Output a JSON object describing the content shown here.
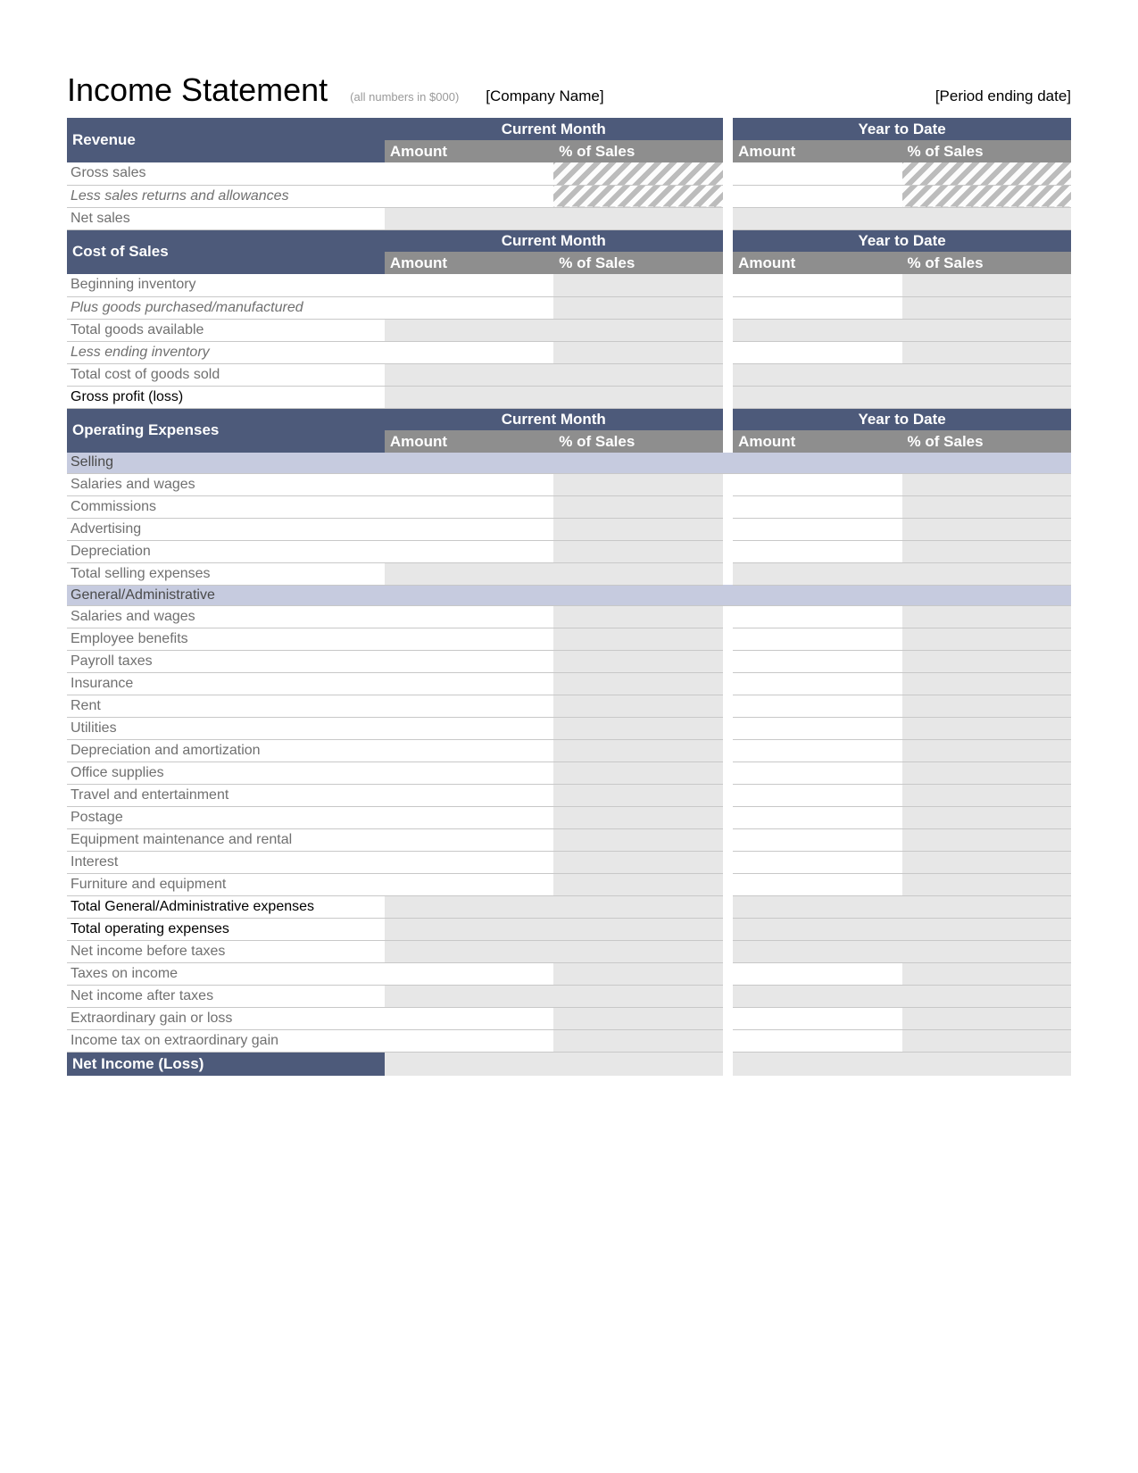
{
  "header": {
    "title": "Income Statement",
    "subtitle": "(all numbers in $000)",
    "company": "[Company Name]",
    "period": "[Period ending date]"
  },
  "col_headers": {
    "period_current": "Current Month",
    "period_ytd": "Year to Date",
    "amount": "Amount",
    "pct": "% of Sales"
  },
  "sections": {
    "revenue": {
      "title": "Revenue",
      "rows": [
        {
          "label": "Gross sales"
        },
        {
          "label": "Less sales returns and allowances"
        },
        {
          "label": "Net sales"
        }
      ]
    },
    "cost_of_sales": {
      "title": "Cost of Sales",
      "rows": [
        {
          "label": "Beginning inventory"
        },
        {
          "label": "Plus goods purchased/manufactured"
        },
        {
          "label": "Total goods available"
        },
        {
          "label": "Less ending inventory"
        },
        {
          "label": "Total cost of goods sold"
        },
        {
          "label": "Gross profit (loss)"
        }
      ]
    },
    "operating_expenses": {
      "title": "Operating Expenses",
      "selling": {
        "title": "Selling",
        "rows": [
          {
            "label": "Salaries and wages"
          },
          {
            "label": "Commissions"
          },
          {
            "label": "Advertising"
          },
          {
            "label": "Depreciation"
          },
          {
            "label": "Total selling expenses"
          }
        ]
      },
      "general": {
        "title": "General/Administrative",
        "rows": [
          {
            "label": "Salaries and wages"
          },
          {
            "label": "Employee benefits"
          },
          {
            "label": "Payroll taxes"
          },
          {
            "label": "Insurance"
          },
          {
            "label": "Rent"
          },
          {
            "label": "Utilities"
          },
          {
            "label": "Depreciation and amortization"
          },
          {
            "label": "Office supplies"
          },
          {
            "label": "Travel and entertainment"
          },
          {
            "label": "Postage"
          },
          {
            "label": "Equipment maintenance and rental"
          },
          {
            "label": "Interest"
          },
          {
            "label": "Furniture and equipment"
          },
          {
            "label": "Total General/Administrative expenses"
          },
          {
            "label": "Total operating expenses"
          },
          {
            "label": "Net income before taxes"
          },
          {
            "label": "Taxes on income"
          },
          {
            "label": "Net income after taxes"
          },
          {
            "label": "Extraordinary gain or loss"
          },
          {
            "label": "Income tax on extraordinary gain"
          }
        ]
      }
    },
    "net_income": {
      "title": "Net Income (Loss)"
    }
  }
}
